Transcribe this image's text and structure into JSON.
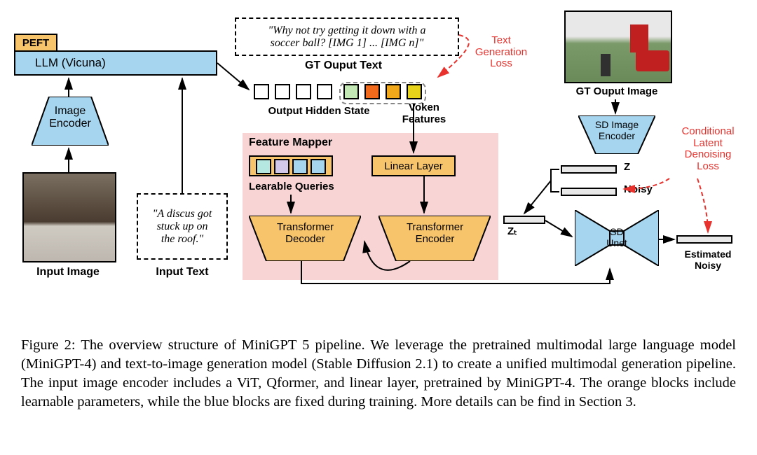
{
  "llm": {
    "peft": "PEFT",
    "name": "LLM (Vicuna)"
  },
  "encoder": {
    "image": "Image\nEncoder",
    "sd_image": "SD Image\nEncoder",
    "sd_unet": "SD\nUnet"
  },
  "labels": {
    "input_image": "Input Image",
    "input_text": "Input Text",
    "input_text_value": "\"A discus got\nstuck up on\nthe roof.\"",
    "gt_output_text": "GT Ouput Text",
    "gt_output_text_value": "\"Why not try getting it down with a\nsoccer ball? [IMG 1] ... [IMG n]\"",
    "output_hidden_state": "Output Hidden State",
    "voken_features": "Voken\nFeatures",
    "text_gen_loss": "Text\nGeneration\nLoss",
    "gt_output_image": "GT Ouput Image",
    "feature_mapper": "Feature Mapper",
    "learnable_queries": "Learable Queries",
    "linear_layer": "Linear Layer",
    "transformer_decoder": "Transformer\nDecoder",
    "transformer_encoder": "Transformer\nEncoder",
    "z": "Z",
    "noisy": "Noisy",
    "zt": "Zₜ",
    "estimated_noisy": "Estimated\nNoisy",
    "cond_loss": "Conditional\nLatent\nDenoising\nLoss"
  },
  "caption": "Figure 2: The overview structure of MiniGPT 5 pipeline. We leverage the pretrained multimodal large language model (MiniGPT-4) and text-to-image generation model (Stable Diffusion 2.1) to create a unified multimodal generation pipeline. The input image encoder includes a ViT, Qformer, and linear layer, pretrained by MiniGPT-4. The orange blocks include learnable parameters, while the blue blocks are fixed during training. More details can be find in Section 3."
}
